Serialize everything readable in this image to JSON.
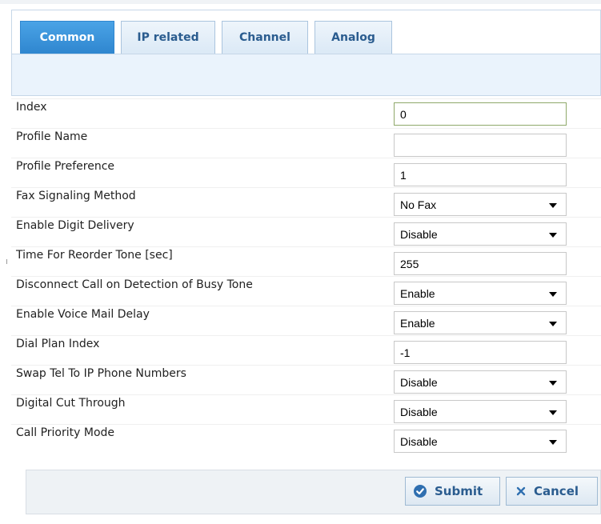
{
  "tabs": [
    {
      "label": "Common",
      "active": true
    },
    {
      "label": "IP related",
      "active": false
    },
    {
      "label": "Channel",
      "active": false
    },
    {
      "label": "Analog",
      "active": false
    }
  ],
  "fields": [
    {
      "label": "Index",
      "type": "text",
      "value": "0"
    },
    {
      "label": "Profile Name",
      "type": "text",
      "value": ""
    },
    {
      "label": "Profile Preference",
      "type": "text",
      "value": "1"
    },
    {
      "label": "Fax Signaling Method",
      "type": "select",
      "value": "No Fax"
    },
    {
      "label": "Enable Digit Delivery",
      "type": "select",
      "value": "Disable"
    },
    {
      "label": "Time For Reorder Tone [sec]",
      "type": "text",
      "value": "255"
    },
    {
      "label": "Disconnect Call on Detection of Busy Tone",
      "type": "select",
      "value": "Enable"
    },
    {
      "label": "Enable Voice Mail Delay",
      "type": "select",
      "value": "Enable"
    },
    {
      "label": "Dial Plan Index",
      "type": "text",
      "value": "-1"
    },
    {
      "label": "Swap Tel To IP Phone Numbers",
      "type": "select",
      "value": "Disable"
    },
    {
      "label": "Digital Cut Through",
      "type": "select",
      "value": "Disable"
    },
    {
      "label": "Call Priority Mode",
      "type": "select",
      "value": "Disable"
    }
  ],
  "buttons": {
    "submit": {
      "label": "Submit",
      "icon": "check-circle-icon"
    },
    "cancel": {
      "label": "Cancel",
      "icon": "x-icon"
    }
  },
  "colors": {
    "accent": "#2f86cf",
    "link_text": "#2a5c8f",
    "panel_bg": "#eaf3fc"
  }
}
